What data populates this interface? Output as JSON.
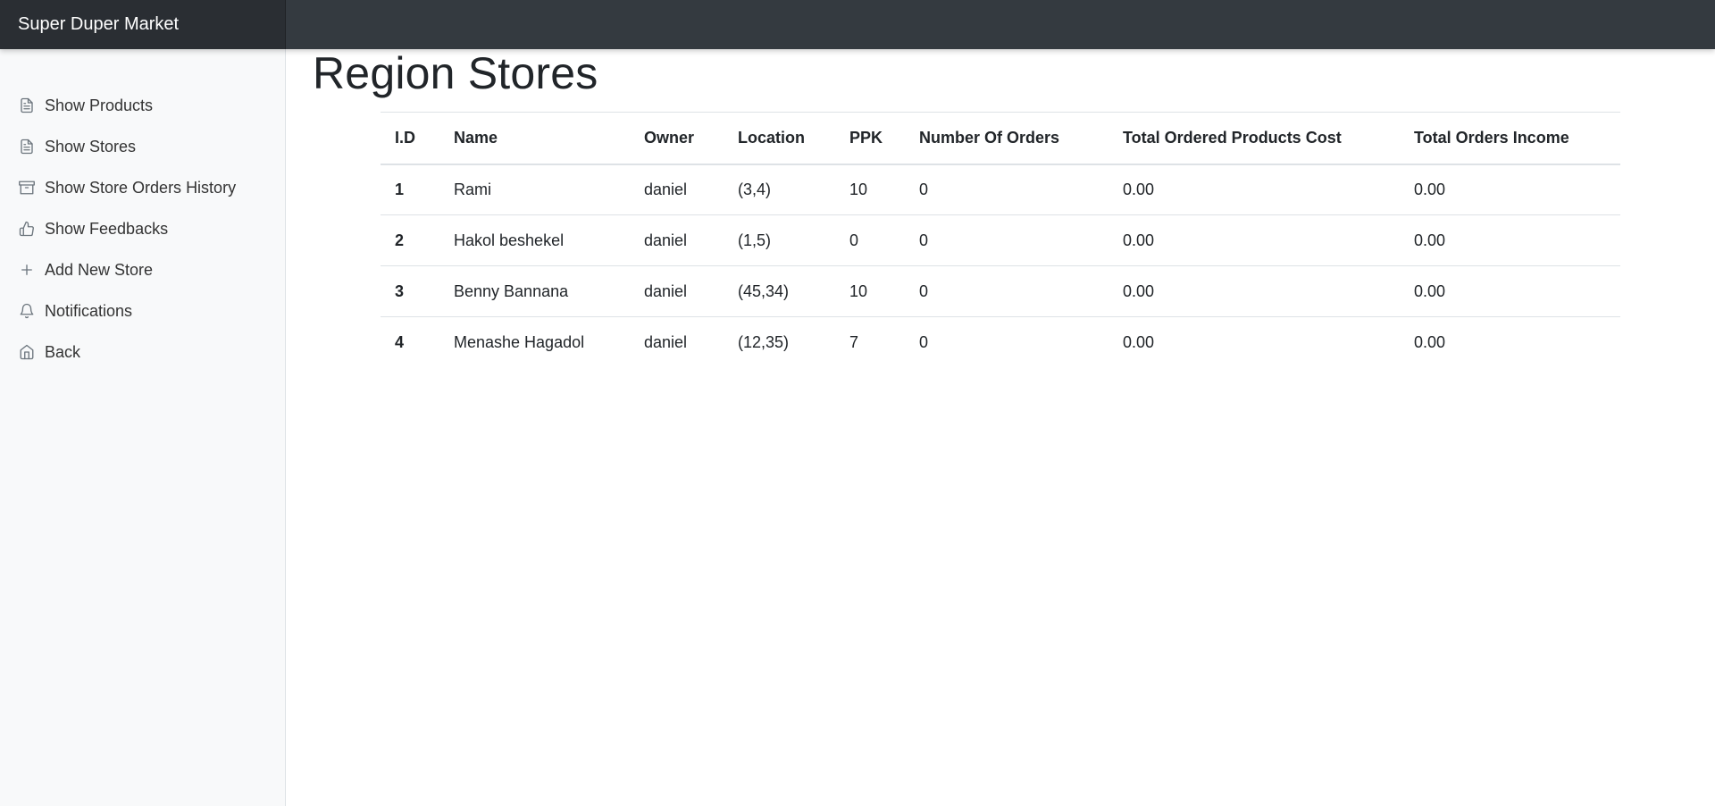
{
  "app": {
    "brand": "Super Duper Market"
  },
  "sidebar": {
    "items": [
      {
        "label": "Show Products",
        "icon": "document-icon"
      },
      {
        "label": "Show Stores",
        "icon": "document-icon"
      },
      {
        "label": "Show Store Orders History",
        "icon": "archive-icon"
      },
      {
        "label": "Show Feedbacks",
        "icon": "thumbs-up-icon"
      },
      {
        "label": "Add New Store",
        "icon": "plus-icon"
      },
      {
        "label": "Notifications",
        "icon": "bell-icon"
      },
      {
        "label": "Back",
        "icon": "home-icon"
      }
    ]
  },
  "page": {
    "title": "Region Stores"
  },
  "table": {
    "headers": [
      "I.D",
      "Name",
      "Owner",
      "Location",
      "PPK",
      "Number Of Orders",
      "Total Ordered Products Cost",
      "Total Orders Income"
    ],
    "rows": [
      [
        "1",
        "Rami",
        "daniel",
        "(3,4)",
        "10",
        "0",
        "0.00",
        "0.00"
      ],
      [
        "2",
        "Hakol beshekel",
        "daniel",
        "(1,5)",
        "0",
        "0",
        "0.00",
        "0.00"
      ],
      [
        "3",
        "Benny Bannana",
        "daniel",
        "(45,34)",
        "10",
        "0",
        "0.00",
        "0.00"
      ],
      [
        "4",
        "Menashe Hagadol",
        "daniel",
        "(12,35)",
        "7",
        "0",
        "0.00",
        "0.00"
      ]
    ]
  },
  "colors": {
    "topbar": "#343a40",
    "brand_bg": "#2a2e33",
    "sidebar_bg": "#f8f9fa",
    "text": "#212529",
    "border": "#dee2e6"
  }
}
